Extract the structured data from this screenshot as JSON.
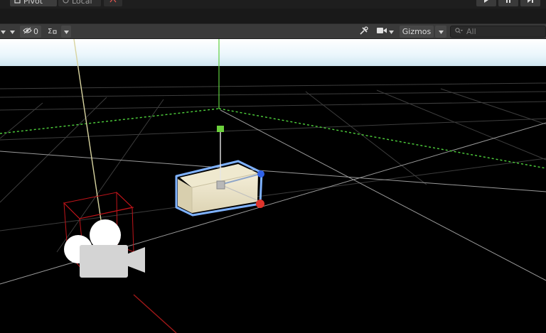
{
  "topbar": {
    "pivot_label": "Pivot",
    "local_label": "Local",
    "play_icons": [
      "play-icon",
      "pause-icon",
      "step-icon"
    ]
  },
  "toolbar": {
    "hidden_count": "0",
    "gizmos_label": "Gizmos",
    "search_placeholder": "All"
  },
  "colors": {
    "x_axis": "#e0342b",
    "y_axis": "#6cd13c",
    "z_axis": "#2f62e8",
    "selection_outline": "#7fb2ff",
    "camera_frustum": "#c0141a"
  }
}
